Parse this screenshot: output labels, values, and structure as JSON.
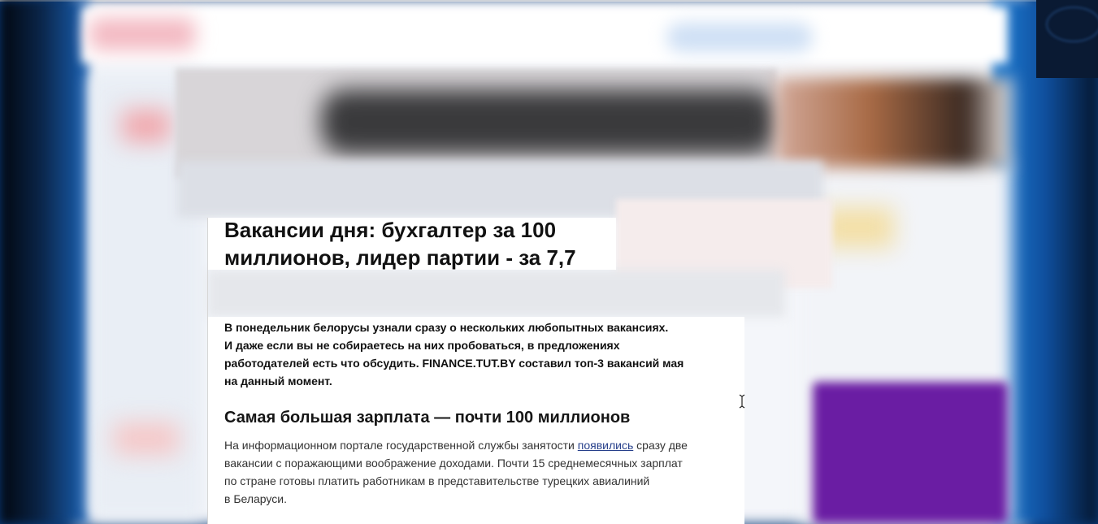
{
  "article": {
    "title_line1": "Вакансии дня: бухгалтер за 100",
    "title_line2": "миллионов, лидер партии - за 7,7",
    "lead_lines": [
      "В понедельник белорусы узнали сразу о нескольких любопытных вакансиях.",
      "И даже если вы не собираетесь на них пробоваться, в предложениях",
      "работодателей есть что обсудить. FINANCE.TUT.BY составил топ-3 вакансий мая",
      "на данный момент."
    ],
    "subheading": "Самая большая зарплата — почти 100 миллионов",
    "body": {
      "before_link": "На информационном портале государственной службы занятости ",
      "link_text": "появились",
      "after_link_line1": " сразу две",
      "line2": "вакансии с поражающими воображение доходами. Почти 15 среднемесячных зарплат",
      "line3": "по стране готовы платить работникам в представительстве турецких авиалиний",
      "line4": "в Беларуси."
    }
  },
  "colors": {
    "link": "#27408b",
    "ad_purple": "#6a1da3",
    "title": "#111111",
    "body": "#333333"
  },
  "icons": {
    "cursor": "text-cursor-icon"
  }
}
